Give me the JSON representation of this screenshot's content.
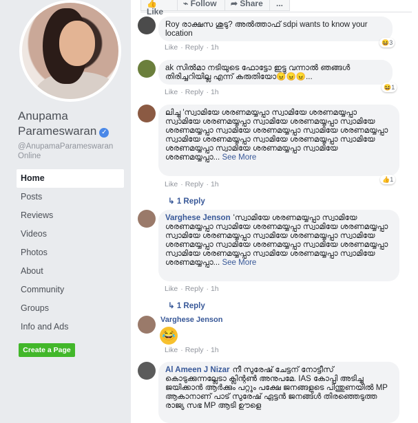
{
  "sidebar": {
    "page_name": "Anupama Parameswaran",
    "verified_icon": "verified-badge-icon",
    "handle": "@AnupamaParameswaran Online",
    "nav": [
      {
        "label": "Home",
        "active": true
      },
      {
        "label": "Posts"
      },
      {
        "label": "Reviews"
      },
      {
        "label": "Videos"
      },
      {
        "label": "Photos"
      },
      {
        "label": "About"
      },
      {
        "label": "Community"
      },
      {
        "label": "Groups"
      },
      {
        "label": "Info and Ads"
      }
    ],
    "create_page": "Create a Page"
  },
  "actions": {
    "like": "Like",
    "follow": "Follow",
    "share": "Share",
    "more": "..."
  },
  "comments": [
    {
      "author": "",
      "text": "Roy രാക്ഷസ ശുടു? അൽത്താഫ് sdpi wants to know your location",
      "like": "Like",
      "reply": "Reply",
      "time": "1h",
      "reaction": "😆",
      "reaction_count": "3"
    },
    {
      "author": "",
      "text": "ak സിൽമാ നടിയുടെ ഫോട്ടോ ഇട്ടു വന്നാൽ ഞങ്ങൾ തിരിച്ചറിയില്ല എന്ന് കരുതിയോ😠😠😠...",
      "like": "Like",
      "reply": "Reply",
      "time": "1h",
      "reaction": "😆",
      "reaction_count": "1"
    },
    {
      "author": "",
      "text": "ലിച്ചു 'സ്വാമിയേ ശരണമയ്യപ്പാ സ്വാമിയേ ശരണമയ്യപ്പാ സ്വാമിയേ ശരണമയ്യപ്പാ സ്വാമിയേ ശരണമയ്യപ്പാ സ്വാമിയേ ശരണമയ്യപ്പാ സ്വാമിയേ ശരണമയ്യപ്പാ സ്വാമിയേ ശരണമയ്യപ്പാ സ്വാമിയേ ശരണമയ്യപ്പാ സ്വാമിയേ ശരണമയ്യപ്പാ സ്വാമിയേ ശരണമയ്യപ്പാ സ്വാമിയേ ശരണമയ്യപ്പാ സ്വാമിയേ ശരണമയ്യപ്പാ...",
      "see_more": "See More",
      "like": "Like",
      "reply": "Reply",
      "time": "1h",
      "reaction": "👍",
      "reaction_count": "1",
      "replies": "1 Reply"
    },
    {
      "author": "Varghese Jenson",
      "text": "'സ്വാമിയേ ശരണമയ്യപ്പാ സ്വാമിയേ ശരണമയ്യപ്പാ സ്വാമിയേ ശരണമയ്യപ്പാ സ്വാമിയേ ശരണമയ്യപ്പാ സ്വാമിയേ ശരണമയ്യപ്പാ സ്വാമിയേ ശരണമയ്യപ്പാ സ്വാമിയേ ശരണമയ്യപ്പാ സ്വാമിയേ ശരണമയ്യപ്പാ സ്വാമിയേ ശരണമയ്യപ്പാ സ്വാമിയേ ശരണമയ്യപ്പാ സ്വാമിയേ ശരണമയ്യപ്പാ സ്വാമിയേ ശരണമയ്യപ്പാ...",
      "see_more": "See More",
      "like": "Like",
      "reply": "Reply",
      "time": "1h",
      "replies": "1 Reply"
    },
    {
      "author": "Varghese Jenson",
      "text": "😂",
      "like": "Like",
      "reply": "Reply",
      "time": "1h"
    },
    {
      "author": "Al Ameen J Nizar",
      "text": "നീ സുരേഷ് ചേട്ടന് നോട്ടീസ് കൊടുക്കുന്നല്ലേടാ ക്ലിന്റൺ അനുപമേ. IAS കോപ്പി അടിച്ചു ജയിക്കാൻ ആർക്കും പറ്റും പക്ഷേ ജനങ്ങളുടെ പിന്തുണയിൽ MP ആകാനാണ് പാട് സുരേഷ് ഏട്ടൻ ജനങ്ങൾ തിരഞ്ഞെടുത്ത രാജ്യ സഭ MP ആടി ഊളെ"
    }
  ]
}
